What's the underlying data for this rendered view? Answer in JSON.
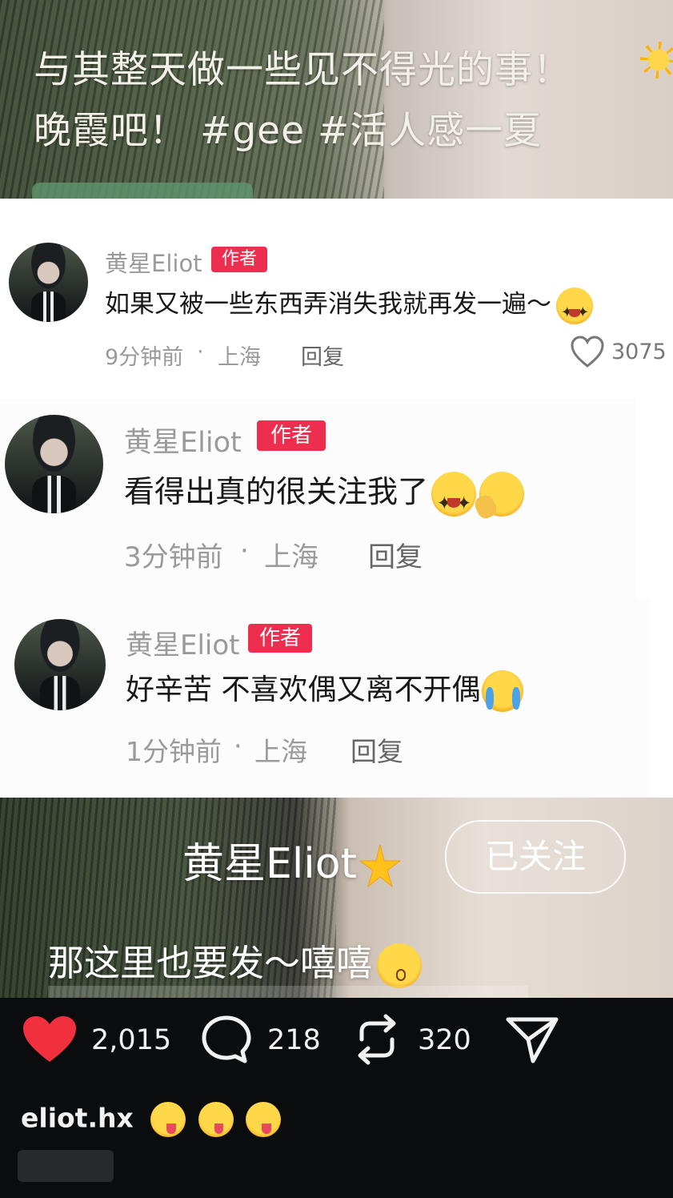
{
  "top_video": {
    "caption_line1": "与其整天做一些见不得光的事！",
    "caption_line2": "晚霞吧！ #gee #活人感一夏"
  },
  "comments": [
    {
      "username": "黄星Eliot",
      "badge": "作者",
      "text": "如果又被一些东西弄消失我就再发一遍～",
      "emojis": [
        "star-eyes-emoji"
      ],
      "time": "9分钟前",
      "separator": "·",
      "location": "上海",
      "reply": "回复",
      "likes": "3075"
    },
    {
      "username": "黄星Eliot",
      "badge": "作者",
      "text": "看得出真的很关注我了",
      "emojis": [
        "star-eyes-emoji",
        "thinking-emoji"
      ],
      "time": "3分钟前",
      "separator": "·",
      "location": "上海",
      "reply": "回复"
    },
    {
      "username": "黄星Eliot",
      "badge": "作者",
      "text": "好辛苦 不喜欢偶又离不开偶",
      "emojis": [
        "loudly-crying-emoji"
      ],
      "time": "1分钟前",
      "separator": "·",
      "location": "上海",
      "reply": "回复"
    }
  ],
  "bottom_video": {
    "author_name": "黄星Eliot",
    "author_icon": "sparkle-star-icon",
    "follow_label": "已关注",
    "caption": "那这里也要发～嘻嘻",
    "caption_icon": "kissing-emoji"
  },
  "action_bar": {
    "likes": "2,015",
    "comments": "218",
    "reposts": "320",
    "like_color": "#f1303e",
    "handle": "eliot.hx",
    "handle_icons": [
      "zany-face-emoji",
      "zany-face-emoji",
      "zany-face-emoji"
    ]
  }
}
